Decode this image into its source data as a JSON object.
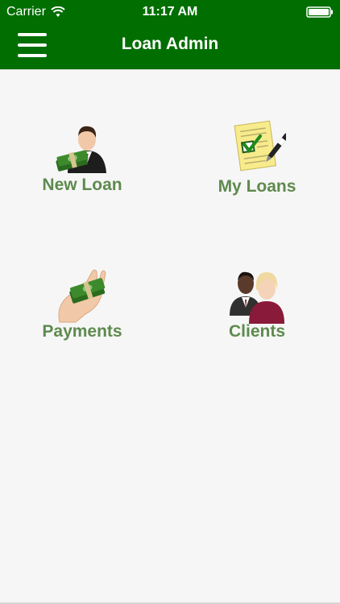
{
  "status_bar": {
    "carrier": "Carrier",
    "time": "11:17 AM",
    "wifi_icon": "wifi-icon",
    "battery_icon": "battery-icon"
  },
  "nav_bar": {
    "title": "Loan Admin",
    "menu_icon": "hamburger-menu-icon"
  },
  "colors": {
    "header_bg": "#006e00",
    "tile_label": "#5e8a4e",
    "page_bg": "#f6f6f6"
  },
  "tiles": [
    {
      "label": "New Loan",
      "icon": "businessman-money-icon"
    },
    {
      "label": "My Loans",
      "icon": "document-checklist-icon"
    },
    {
      "label": "Payments",
      "icon": "hand-money-icon"
    },
    {
      "label": "Clients",
      "icon": "clients-people-icon"
    }
  ]
}
